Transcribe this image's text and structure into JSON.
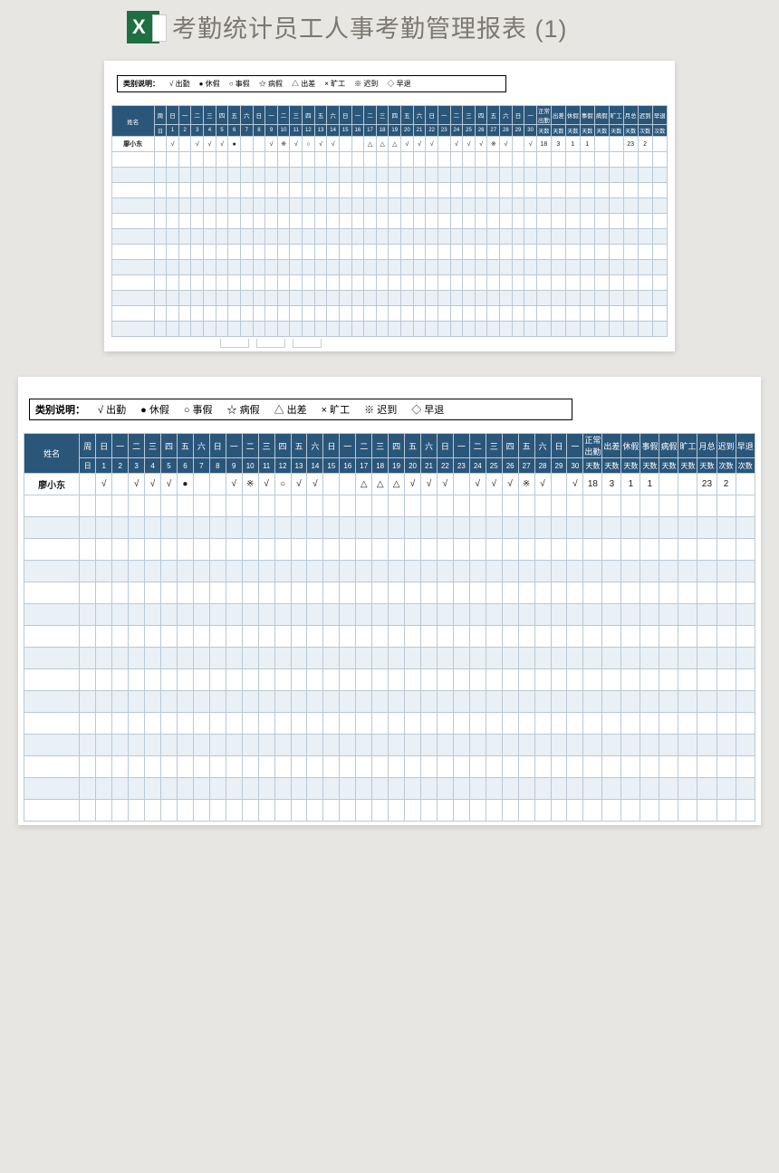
{
  "doc_title": "考勤统计员工人事考勤管理报表 (1)",
  "legend": {
    "label": "类别说明：",
    "items": [
      {
        "sym": "√",
        "txt": "出勤"
      },
      {
        "sym": "●",
        "txt": "休假"
      },
      {
        "sym": "○",
        "txt": "事假"
      },
      {
        "sym": "☆",
        "txt": "病假"
      },
      {
        "sym": "△",
        "txt": "出差"
      },
      {
        "sym": "×",
        "txt": "旷工"
      },
      {
        "sym": "※",
        "txt": "迟到"
      },
      {
        "sym": "◇",
        "txt": "早退"
      }
    ]
  },
  "header": {
    "name_label": "姓名",
    "week_label": "周",
    "day_label": "日",
    "weekdays": [
      "日",
      "一",
      "二",
      "三",
      "四",
      "五",
      "六",
      "日",
      "一",
      "二",
      "三",
      "四",
      "五",
      "六",
      "日",
      "一",
      "二",
      "三",
      "四",
      "五",
      "六",
      "日",
      "一",
      "二",
      "三",
      "四",
      "五",
      "六",
      "日",
      "一"
    ],
    "days": [
      "1",
      "2",
      "3",
      "4",
      "5",
      "6",
      "7",
      "8",
      "9",
      "10",
      "11",
      "12",
      "13",
      "14",
      "15",
      "16",
      "17",
      "18",
      "19",
      "20",
      "21",
      "22",
      "23",
      "24",
      "25",
      "26",
      "27",
      "28",
      "29",
      "30"
    ],
    "summary_top": [
      "正常出勤",
      "出差",
      "休假",
      "事假",
      "病假",
      "旷工",
      "月总",
      "迟到",
      "早退"
    ],
    "summary_sub": [
      "天数",
      "天数",
      "天数",
      "天数",
      "天数",
      "天数",
      "天数",
      "次数",
      "次数"
    ]
  },
  "rows": [
    {
      "name": "廖小东",
      "cells": [
        "√",
        "",
        "√",
        "√",
        "√",
        "●",
        "",
        "",
        "√",
        "※",
        "√",
        "○",
        "√",
        "√",
        "",
        "",
        "△",
        "△",
        "△",
        "√",
        "√",
        "√",
        "",
        "√",
        "√",
        "√",
        "※",
        "√",
        "",
        "√"
      ],
      "sums": [
        "18",
        "3",
        "1",
        "1",
        "",
        "",
        "23",
        "2",
        ""
      ]
    },
    {
      "name": "",
      "cells": [
        "",
        "",
        "",
        "",
        "",
        "",
        "",
        "",
        "",
        "",
        "",
        "",
        "",
        "",
        "",
        "",
        "",
        "",
        "",
        "",
        "",
        "",
        "",
        "",
        "",
        "",
        "",
        "",
        "",
        ""
      ],
      "sums": [
        "",
        "",
        "",
        "",
        "",
        "",
        "",
        "",
        ""
      ]
    },
    {
      "name": "",
      "cells": [
        "",
        "",
        "",
        "",
        "",
        "",
        "",
        "",
        "",
        "",
        "",
        "",
        "",
        "",
        "",
        "",
        "",
        "",
        "",
        "",
        "",
        "",
        "",
        "",
        "",
        "",
        "",
        "",
        "",
        ""
      ],
      "sums": [
        "",
        "",
        "",
        "",
        "",
        "",
        "",
        "",
        ""
      ]
    },
    {
      "name": "",
      "cells": [
        "",
        "",
        "",
        "",
        "",
        "",
        "",
        "",
        "",
        "",
        "",
        "",
        "",
        "",
        "",
        "",
        "",
        "",
        "",
        "",
        "",
        "",
        "",
        "",
        "",
        "",
        "",
        "",
        "",
        ""
      ],
      "sums": [
        "",
        "",
        "",
        "",
        "",
        "",
        "",
        "",
        ""
      ]
    },
    {
      "name": "",
      "cells": [
        "",
        "",
        "",
        "",
        "",
        "",
        "",
        "",
        "",
        "",
        "",
        "",
        "",
        "",
        "",
        "",
        "",
        "",
        "",
        "",
        "",
        "",
        "",
        "",
        "",
        "",
        "",
        "",
        "",
        ""
      ],
      "sums": [
        "",
        "",
        "",
        "",
        "",
        "",
        "",
        "",
        ""
      ]
    },
    {
      "name": "",
      "cells": [
        "",
        "",
        "",
        "",
        "",
        "",
        "",
        "",
        "",
        "",
        "",
        "",
        "",
        "",
        "",
        "",
        "",
        "",
        "",
        "",
        "",
        "",
        "",
        "",
        "",
        "",
        "",
        "",
        "",
        ""
      ],
      "sums": [
        "",
        "",
        "",
        "",
        "",
        "",
        "",
        "",
        ""
      ]
    },
    {
      "name": "",
      "cells": [
        "",
        "",
        "",
        "",
        "",
        "",
        "",
        "",
        "",
        "",
        "",
        "",
        "",
        "",
        "",
        "",
        "",
        "",
        "",
        "",
        "",
        "",
        "",
        "",
        "",
        "",
        "",
        "",
        "",
        ""
      ],
      "sums": [
        "",
        "",
        "",
        "",
        "",
        "",
        "",
        "",
        ""
      ]
    },
    {
      "name": "",
      "cells": [
        "",
        "",
        "",
        "",
        "",
        "",
        "",
        "",
        "",
        "",
        "",
        "",
        "",
        "",
        "",
        "",
        "",
        "",
        "",
        "",
        "",
        "",
        "",
        "",
        "",
        "",
        "",
        "",
        "",
        ""
      ],
      "sums": [
        "",
        "",
        "",
        "",
        "",
        "",
        "",
        "",
        ""
      ]
    },
    {
      "name": "",
      "cells": [
        "",
        "",
        "",
        "",
        "",
        "",
        "",
        "",
        "",
        "",
        "",
        "",
        "",
        "",
        "",
        "",
        "",
        "",
        "",
        "",
        "",
        "",
        "",
        "",
        "",
        "",
        "",
        "",
        "",
        ""
      ],
      "sums": [
        "",
        "",
        "",
        "",
        "",
        "",
        "",
        "",
        ""
      ]
    },
    {
      "name": "",
      "cells": [
        "",
        "",
        "",
        "",
        "",
        "",
        "",
        "",
        "",
        "",
        "",
        "",
        "",
        "",
        "",
        "",
        "",
        "",
        "",
        "",
        "",
        "",
        "",
        "",
        "",
        "",
        "",
        "",
        "",
        ""
      ],
      "sums": [
        "",
        "",
        "",
        "",
        "",
        "",
        "",
        "",
        ""
      ]
    },
    {
      "name": "",
      "cells": [
        "",
        "",
        "",
        "",
        "",
        "",
        "",
        "",
        "",
        "",
        "",
        "",
        "",
        "",
        "",
        "",
        "",
        "",
        "",
        "",
        "",
        "",
        "",
        "",
        "",
        "",
        "",
        "",
        "",
        ""
      ],
      "sums": [
        "",
        "",
        "",
        "",
        "",
        "",
        "",
        "",
        ""
      ]
    },
    {
      "name": "",
      "cells": [
        "",
        "",
        "",
        "",
        "",
        "",
        "",
        "",
        "",
        "",
        "",
        "",
        "",
        "",
        "",
        "",
        "",
        "",
        "",
        "",
        "",
        "",
        "",
        "",
        "",
        "",
        "",
        "",
        "",
        ""
      ],
      "sums": [
        "",
        "",
        "",
        "",
        "",
        "",
        "",
        "",
        ""
      ]
    },
    {
      "name": "",
      "cells": [
        "",
        "",
        "",
        "",
        "",
        "",
        "",
        "",
        "",
        "",
        "",
        "",
        "",
        "",
        "",
        "",
        "",
        "",
        "",
        "",
        "",
        "",
        "",
        "",
        "",
        "",
        "",
        "",
        "",
        ""
      ],
      "sums": [
        "",
        "",
        "",
        "",
        "",
        "",
        "",
        "",
        ""
      ]
    }
  ],
  "small_rows_count": 13,
  "large_rows_count": 16,
  "tabs": [
    "",
    "",
    ""
  ]
}
